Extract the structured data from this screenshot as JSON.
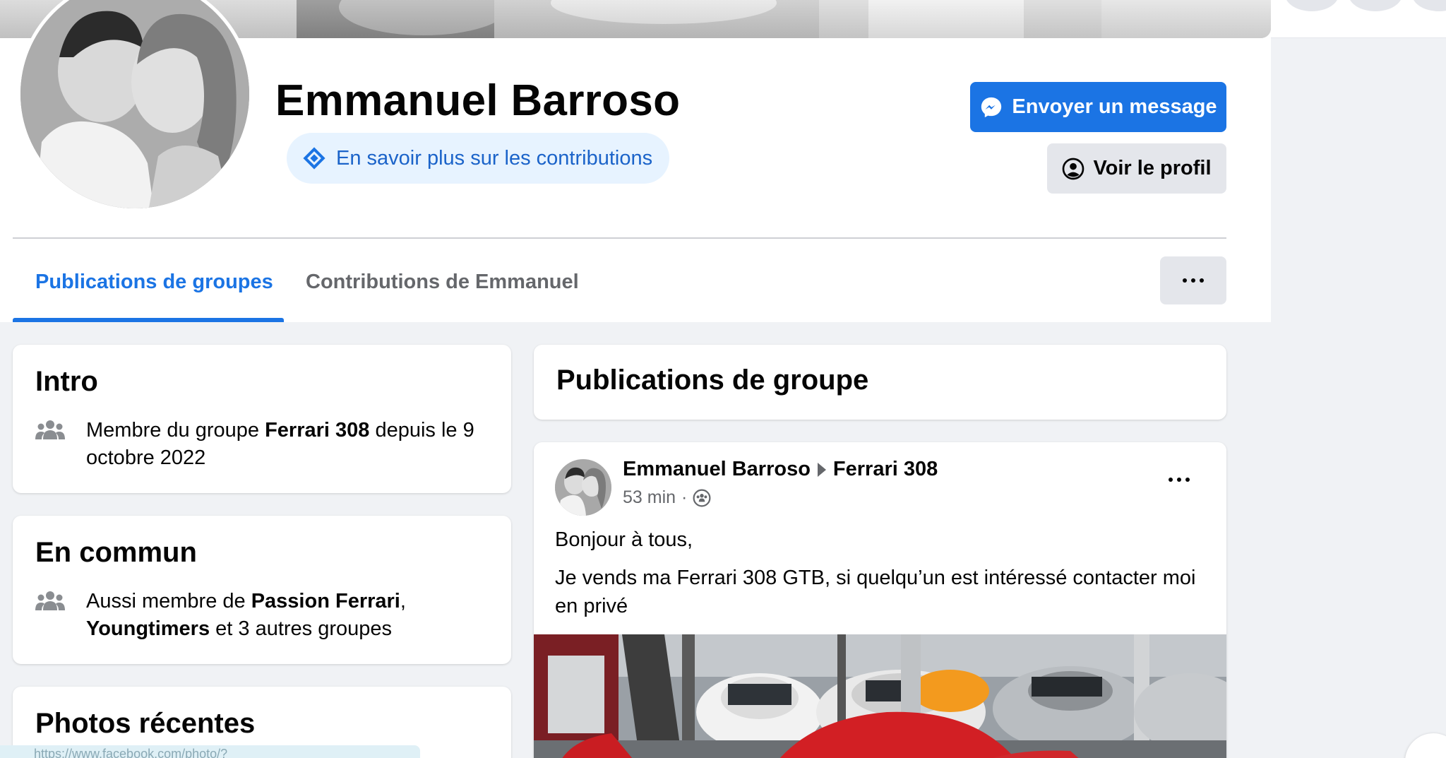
{
  "profile": {
    "name": "Emmanuel Barroso",
    "contributions_link": "En savoir plus sur les contributions",
    "message_button": "Envoyer un message",
    "view_profile_button": "Voir le profil"
  },
  "tabs": [
    {
      "label": "Publications de groupes",
      "active": true
    },
    {
      "label": "Contributions de Emmanuel",
      "active": false
    }
  ],
  "intro": {
    "title": "Intro",
    "text_before": "Membre du groupe ",
    "group": "Ferrari 308",
    "text_after": " depuis le 9 octobre 2022"
  },
  "common": {
    "title": "En commun",
    "text_before": "Aussi membre de ",
    "group1": "Passion Ferrari",
    "separator": ",",
    "group2": "Youngtimers",
    "text_after": " et 3 autres groupes"
  },
  "photos": {
    "title": "Photos récentes"
  },
  "posts_section": {
    "title": "Publications de groupe"
  },
  "post": {
    "author": "Emmanuel Barroso",
    "group": "Ferrari 308",
    "time": "53 min",
    "meta_separator": "·",
    "line1": "Bonjour à tous,",
    "line2": "Je vends ma Ferrari 308 GTB, si quelqu’un est intéressé contacter moi en privé"
  },
  "status_url": "https://www.facebook.com/photo/?fbid=102231688179417243&set=a.40581",
  "colors": {
    "accent": "#1b74e4",
    "background": "#f0f2f5",
    "secondary_text": "#65676b"
  }
}
